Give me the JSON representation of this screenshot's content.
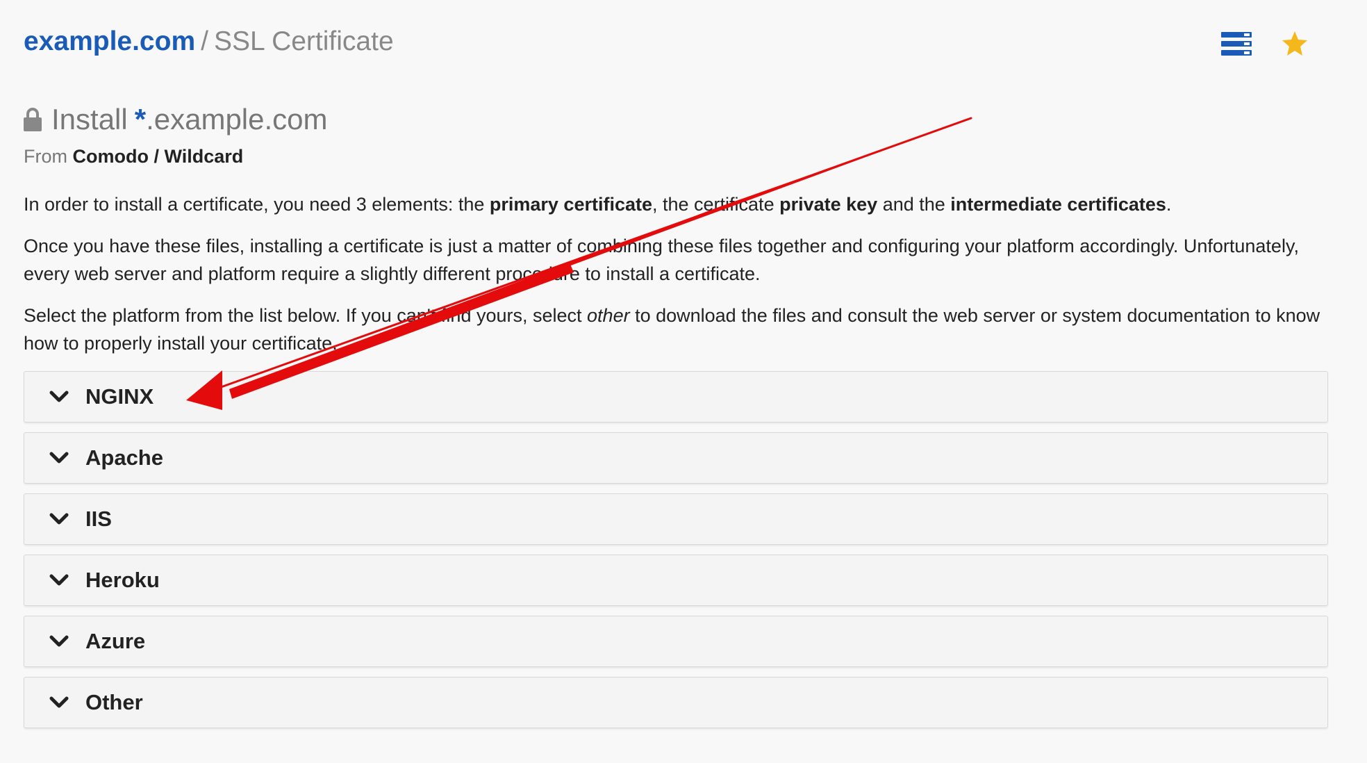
{
  "header": {
    "domain": "example.com",
    "separator": "/",
    "page_title": "SSL Certificate"
  },
  "title": {
    "prefix": "Install",
    "wildcard": "*",
    "domain": ".example.com"
  },
  "subtitle": {
    "from_label": "From",
    "issuer": "Comodo / Wildcard"
  },
  "paragraphs": {
    "p1": {
      "t1": "In order to install a certificate, you need 3 elements: the ",
      "b1": "primary certificate",
      "t2": ", the certificate ",
      "b2": "private key",
      "t3": " and the ",
      "b3": "intermediate certificates",
      "t4": "."
    },
    "p2": "Once you have these files, installing a certificate is just a matter of combining these files together and configuring your platform accordingly. Unfortunately, every web server and platform require a slightly different procedure to install a certificate.",
    "p3": {
      "t1": "Select the platform from the list below. If you can't find yours, select ",
      "i1": "other",
      "t2": " to download the files and consult the web server or system documentation to know how to properly install your certificate."
    }
  },
  "platforms": [
    {
      "label": "NGINX"
    },
    {
      "label": "Apache"
    },
    {
      "label": "IIS"
    },
    {
      "label": "Heroku"
    },
    {
      "label": "Azure"
    },
    {
      "label": "Other"
    }
  ],
  "icons": {
    "list": "list-icon",
    "star": "star-icon",
    "lock": "lock-icon",
    "chevron": "chevron-down-icon"
  },
  "colors": {
    "brand_blue": "#1a5bb8",
    "star_yellow": "#f5b81c",
    "annotation_red": "#e30b0b"
  }
}
